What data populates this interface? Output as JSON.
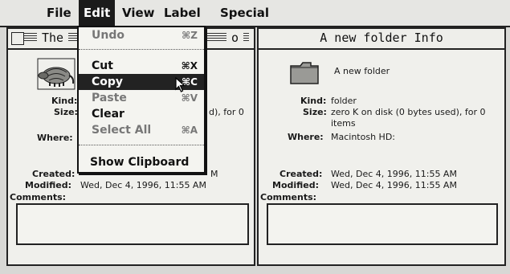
{
  "menubar": {
    "apple_glyph": "",
    "items": [
      "File",
      "Edit",
      "View",
      "Label",
      "Special"
    ]
  },
  "edit_menu": {
    "items": [
      {
        "label": "Undo",
        "shortcut": "⌘Z",
        "disabled": true
      },
      {
        "label": "Cut",
        "shortcut": "⌘X",
        "disabled": false
      },
      {
        "label": "Copy",
        "shortcut": "⌘C",
        "disabled": false,
        "highlighted": true
      },
      {
        "label": "Paste",
        "shortcut": "⌘V",
        "disabled": true
      },
      {
        "label": "Clear",
        "shortcut": "",
        "disabled": false
      },
      {
        "label": "Select All",
        "shortcut": "⌘A",
        "disabled": true
      },
      {
        "label": "Show Clipboard",
        "shortcut": "",
        "disabled": false
      }
    ]
  },
  "left_window": {
    "title": "The",
    "title_right": "o",
    "labels": {
      "kind": "Kind:",
      "size": "Size:",
      "where": "Where:",
      "created": "Created:",
      "modified": "Modified:",
      "comments": "Comments:"
    },
    "size_visible": "d), for 0",
    "created_visible": "M",
    "modified_value": "Wed, Dec 4, 1996, 11:55 AM"
  },
  "right_window": {
    "title": "A new folder Info",
    "name": "A new folder",
    "labels": {
      "kind": "Kind:",
      "size": "Size:",
      "where": "Where:",
      "created": "Created:",
      "modified": "Modified:",
      "comments": "Comments:"
    },
    "kind_value": "folder",
    "size_value": "zero K on disk (0 bytes used), for 0",
    "size_value_line2": "items",
    "where_value": "Macintosh HD:",
    "created_value": "Wed, Dec 4, 1996, 11:55 AM",
    "modified_value": "Wed, Dec 4, 1996, 11:55 AM"
  }
}
